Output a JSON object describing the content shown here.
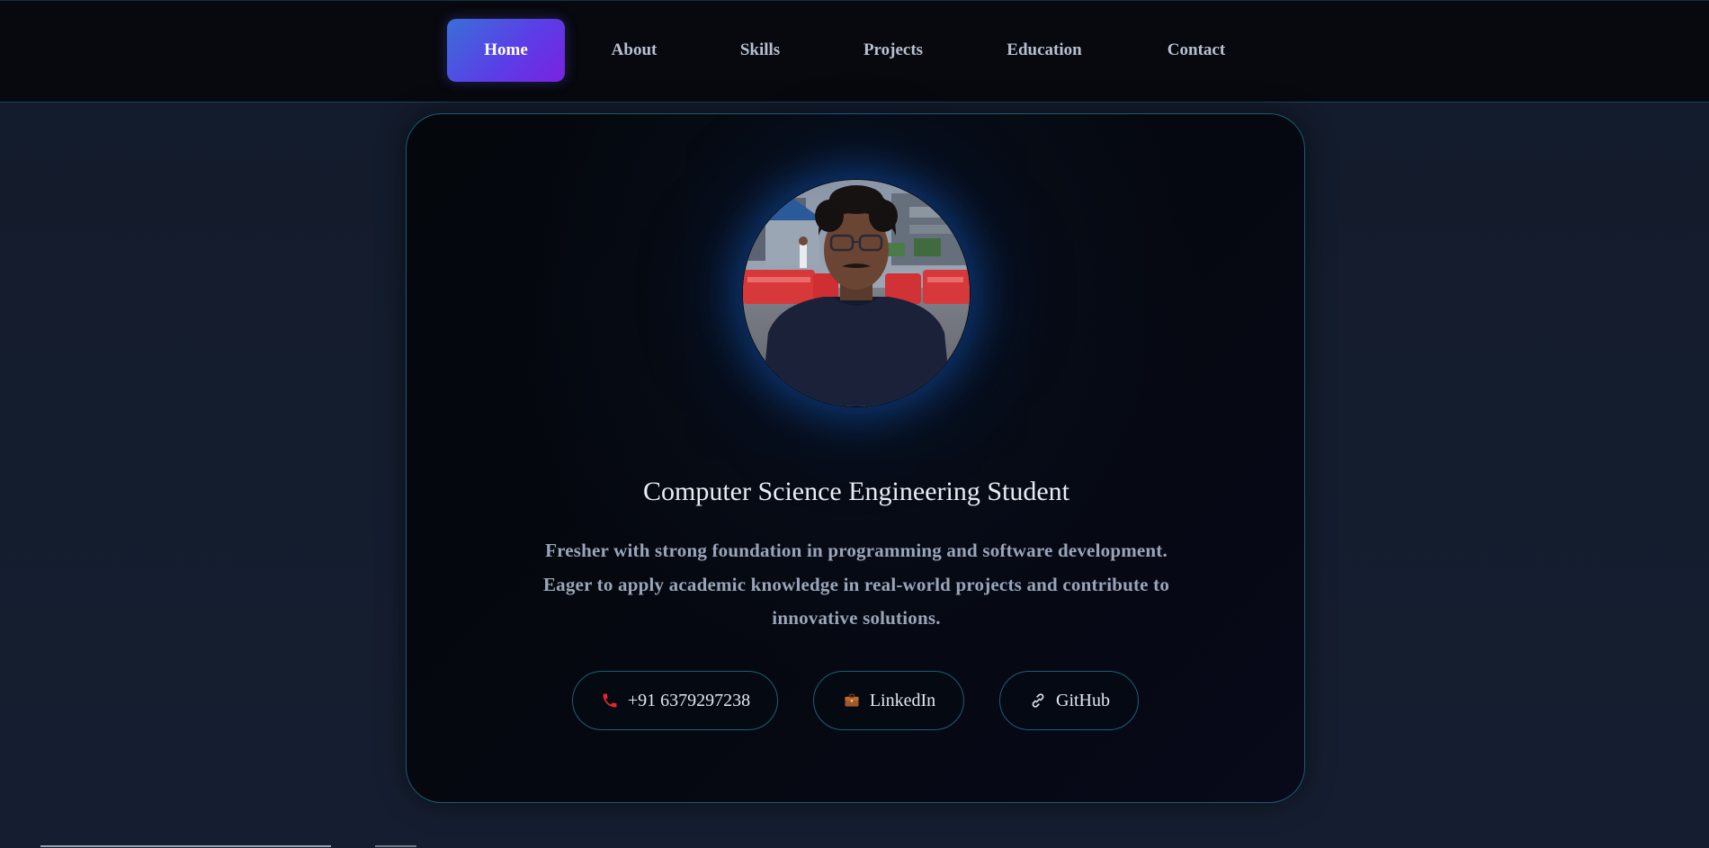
{
  "nav": {
    "items": [
      {
        "label": "Home",
        "active": true
      },
      {
        "label": "About",
        "active": false
      },
      {
        "label": "Skills",
        "active": false
      },
      {
        "label": "Projects",
        "active": false
      },
      {
        "label": "Education",
        "active": false
      },
      {
        "label": "Contact",
        "active": false
      }
    ]
  },
  "hero": {
    "avatar_icon": "profile-photo",
    "title": "Computer Science Engineering Student",
    "description": "Fresher with strong foundation in programming and software development. Eager to apply academic knowledge in real-world projects and contribute to innovative solutions.",
    "contacts": [
      {
        "label": "+91 6379297238",
        "icon": "phone-icon"
      },
      {
        "label": "LinkedIn",
        "icon": "briefcase-icon"
      },
      {
        "label": "GitHub",
        "icon": "link-icon"
      }
    ]
  },
  "colors": {
    "accent_gradient_start": "#3a6fd8",
    "accent_gradient_end": "#7a22e0",
    "border_cyan": "#1b5d72",
    "background": "#131b2b"
  }
}
